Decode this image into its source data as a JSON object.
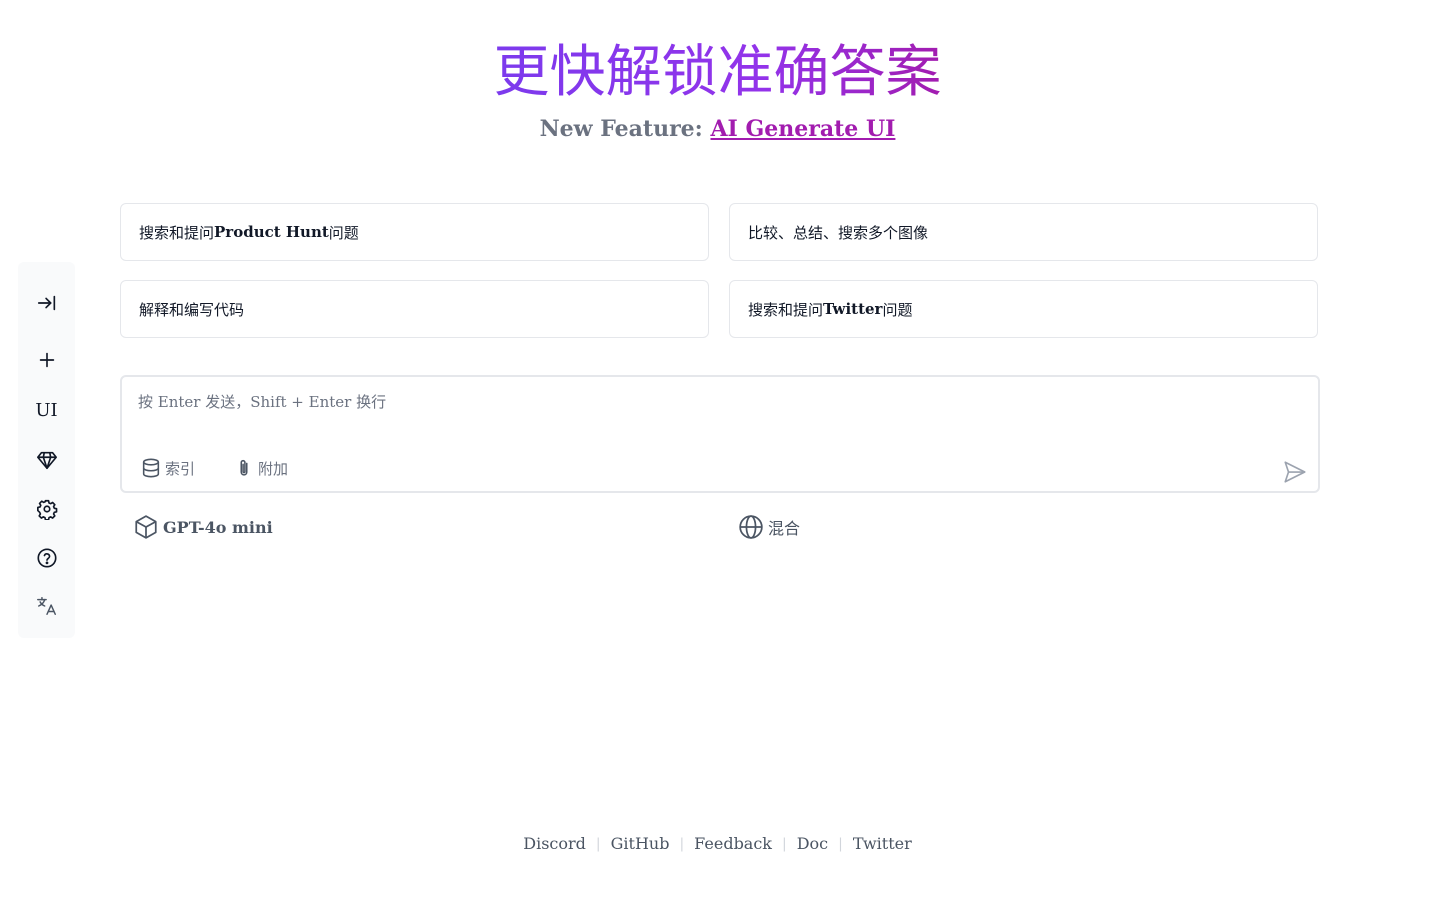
{
  "sidebar": {
    "expand_icon": "arrow-right-to-line-icon",
    "new_icon": "plus-icon",
    "ui_label": "UI",
    "premium_icon": "gem-icon",
    "settings_icon": "gear-icon",
    "help_icon": "question-circle-icon",
    "language_icon": "translate-icon"
  },
  "header": {
    "title": "更快解锁准确答案",
    "subtitle_prefix": "New Feature:",
    "subtitle_link": "AI Generate UI"
  },
  "suggestions": [
    {
      "prefix": "搜索和提问 ",
      "bold": "Product Hunt",
      "suffix": " 问题"
    },
    {
      "prefix": "比较、总结、搜索多个图像",
      "bold": "",
      "suffix": ""
    },
    {
      "prefix": "解释和编写代码",
      "bold": "",
      "suffix": ""
    },
    {
      "prefix": "搜索和提问 ",
      "bold": "Twitter",
      "suffix": " 问题"
    }
  ],
  "input": {
    "value": "",
    "placeholder": "按 Enter 发送，Shift + Enter 换行",
    "index_label": "索引",
    "attach_label": "附加"
  },
  "selectors": {
    "model": "GPT-4o mini",
    "mode": "混合"
  },
  "footer": {
    "links": [
      "Discord",
      "GitHub",
      "Feedback",
      "Doc",
      "Twitter"
    ]
  },
  "colors": {
    "accent": "#9333ea",
    "link": "#a21caf",
    "muted": "#6b7280"
  }
}
